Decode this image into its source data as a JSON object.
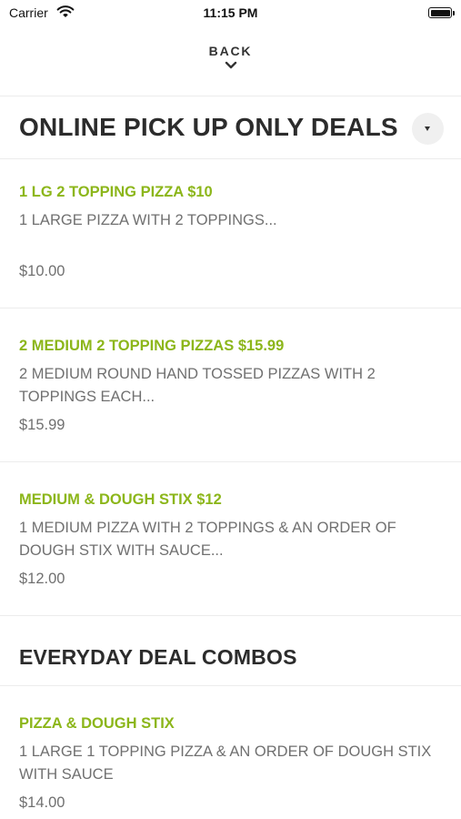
{
  "status_bar": {
    "carrier": "Carrier",
    "time": "11:15 PM"
  },
  "nav": {
    "back_label": "BACK"
  },
  "sections": [
    {
      "title": "ONLINE PICK UP ONLY DEALS",
      "items": [
        {
          "name": "1 LG 2 TOPPING PIZZA $10",
          "description": "1 LARGE PIZZA WITH 2 TOPPINGS...",
          "price": "$10.00"
        },
        {
          "name": "2 MEDIUM 2 TOPPING PIZZAS $15.99",
          "description": "2 MEDIUM ROUND HAND TOSSED PIZZAS WITH 2 TOPPINGS EACH...",
          "price": "$15.99"
        },
        {
          "name": "MEDIUM & DOUGH STIX $12",
          "description": "1 MEDIUM PIZZA WITH 2 TOPPINGS & AN ORDER OF DOUGH STIX WITH SAUCE...",
          "price": "$12.00"
        }
      ]
    },
    {
      "title": "EVERYDAY DEAL COMBOS",
      "items": [
        {
          "name": "PIZZA & DOUGH STIX",
          "description": "1 LARGE 1 TOPPING PIZZA & AN ORDER OF DOUGH STIX WITH SAUCE",
          "price": "$14.00"
        }
      ]
    }
  ],
  "colors": {
    "accent": "#8cb61a",
    "text": "#2c2c2c",
    "muted": "#707070"
  }
}
